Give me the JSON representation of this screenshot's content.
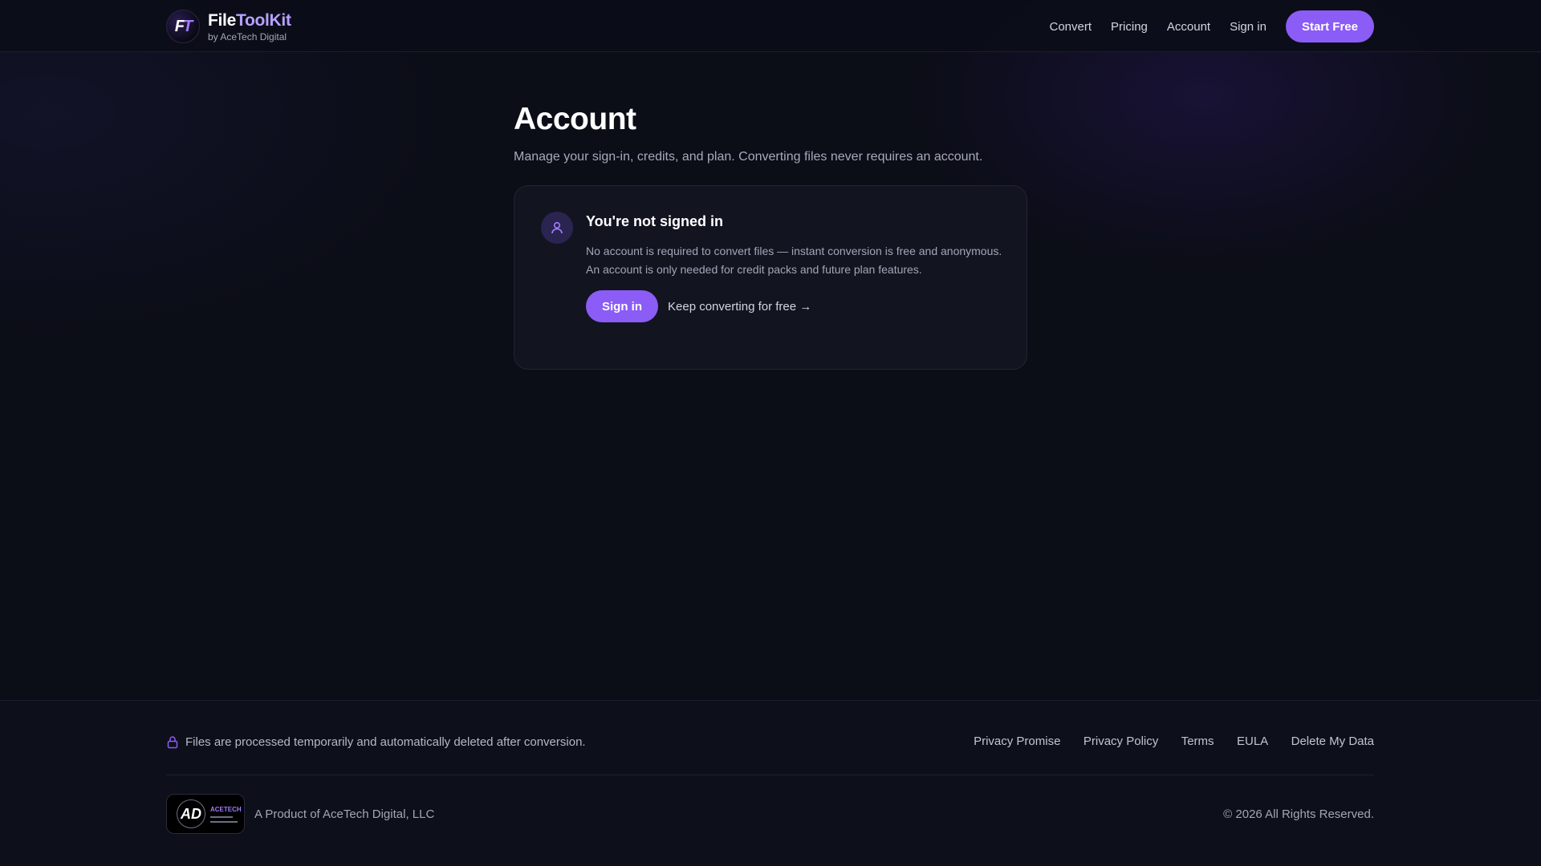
{
  "header": {
    "brand_name_part1": "File",
    "brand_name_part2": "ToolKit",
    "brand_sub": "by AceTech Digital",
    "logo_letters_1": "F",
    "logo_letters_2": "T",
    "nav": [
      "Convert",
      "Pricing",
      "Account",
      "Sign in"
    ],
    "cta": "Start Free"
  },
  "main": {
    "title": "Account",
    "description": "Manage your sign-in, credits, and plan. Converting files never requires an account.",
    "card": {
      "title": "You're not signed in",
      "text": "No account is required to convert files — instant conversion is free and anonymous. An account is only needed for credit packs and future plan features.",
      "signin_label": "Sign in",
      "keep_label": "Keep converting for free →"
    }
  },
  "footer": {
    "notice": "Files are processed temporarily and automatically deleted after conversion.",
    "links": [
      "Privacy Promise",
      "Privacy Policy",
      "Terms",
      "EULA",
      "Delete My Data"
    ],
    "company": "A Product of AceTech Digital, LLC",
    "company_logo_letters": "AD",
    "company_logo_word": "ACETECH",
    "copyright": "© 2026 All Rights Reserved."
  },
  "colors": {
    "accent": "#8b5cf6",
    "accent_light": "#b9a0ff",
    "background": "#0b0d17"
  }
}
